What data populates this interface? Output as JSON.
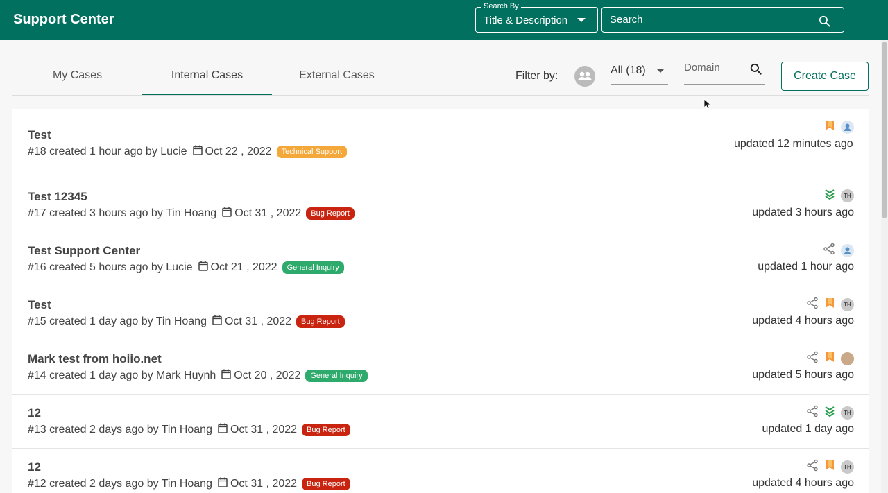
{
  "header": {
    "brand": "Support Center",
    "search_by_label": "Search By",
    "search_by_value": "Title & Description",
    "search_placeholder": "Search"
  },
  "tabs": [
    {
      "label": "My Cases",
      "active": false
    },
    {
      "label": "Internal Cases",
      "active": true
    },
    {
      "label": "External Cases",
      "active": false
    }
  ],
  "filter": {
    "label": "Filter by:",
    "selected": "All (18)",
    "domain_placeholder": "Domain"
  },
  "create_button": "Create Case",
  "colors": {
    "brand": "#02705e",
    "technical_support": "#f4a83a",
    "bug_report": "#c8240f",
    "general_inquiry": "#2eaa6c",
    "bookmark": "#f5973a",
    "chevrons": "#2e9e52"
  },
  "cases": [
    {
      "title": "Test",
      "number": "#18",
      "created": "created 1 hour ago by Lucie",
      "date": "Oct 22 , 2022",
      "category": "Technical Support",
      "category_color": "#f4a83a",
      "updated": "updated 12 minutes ago",
      "icons": [
        "bookmark-icon",
        "user-avatar"
      ]
    },
    {
      "title": "Test 12345",
      "number": "#17",
      "created": "created 3 hours ago by Tin Hoang",
      "date": "Oct 31 , 2022",
      "category": "Bug Report",
      "category_color": "#c8240f",
      "updated": "updated 3 hours ago",
      "icons": [
        "priority-low-icon",
        "TH"
      ]
    },
    {
      "title": "Test Support Center",
      "number": "#16",
      "created": "created 5 hours ago by Lucie",
      "date": "Oct 21 , 2022",
      "category": "General Inquiry",
      "category_color": "#2eaa6c",
      "updated": "updated 1 hour ago",
      "icons": [
        "share-icon",
        "user-avatar"
      ]
    },
    {
      "title": "Test",
      "number": "#15",
      "created": "created 1 day ago by Tin Hoang",
      "date": "Oct 31 , 2022",
      "category": "Bug Report",
      "category_color": "#c8240f",
      "updated": "updated 4 hours ago",
      "icons": [
        "share-icon",
        "bookmark-icon",
        "TH"
      ]
    },
    {
      "title": "Mark test from hoiio.net",
      "number": "#14",
      "created": "created 1 day ago by Mark Huynh",
      "date": "Oct 20 , 2022",
      "category": "General Inquiry",
      "category_color": "#2eaa6c",
      "updated": "updated 5 hours ago",
      "icons": [
        "share-icon",
        "bookmark-icon",
        "photo-avatar"
      ]
    },
    {
      "title": "12",
      "number": "#13",
      "created": "created 2 days ago by Tin Hoang",
      "date": "Oct 31 , 2022",
      "category": "Bug Report",
      "category_color": "#c8240f",
      "updated": "updated 1 day ago",
      "icons": [
        "share-icon",
        "priority-low-icon",
        "TH"
      ]
    },
    {
      "title": "12",
      "number": "#12",
      "created": "created 2 days ago by Tin Hoang",
      "date": "Oct 31 , 2022",
      "category": "Bug Report",
      "category_color": "#c8240f",
      "updated": "updated 4 hours ago",
      "icons": [
        "share-icon",
        "bookmark-icon",
        "TH"
      ]
    }
  ]
}
